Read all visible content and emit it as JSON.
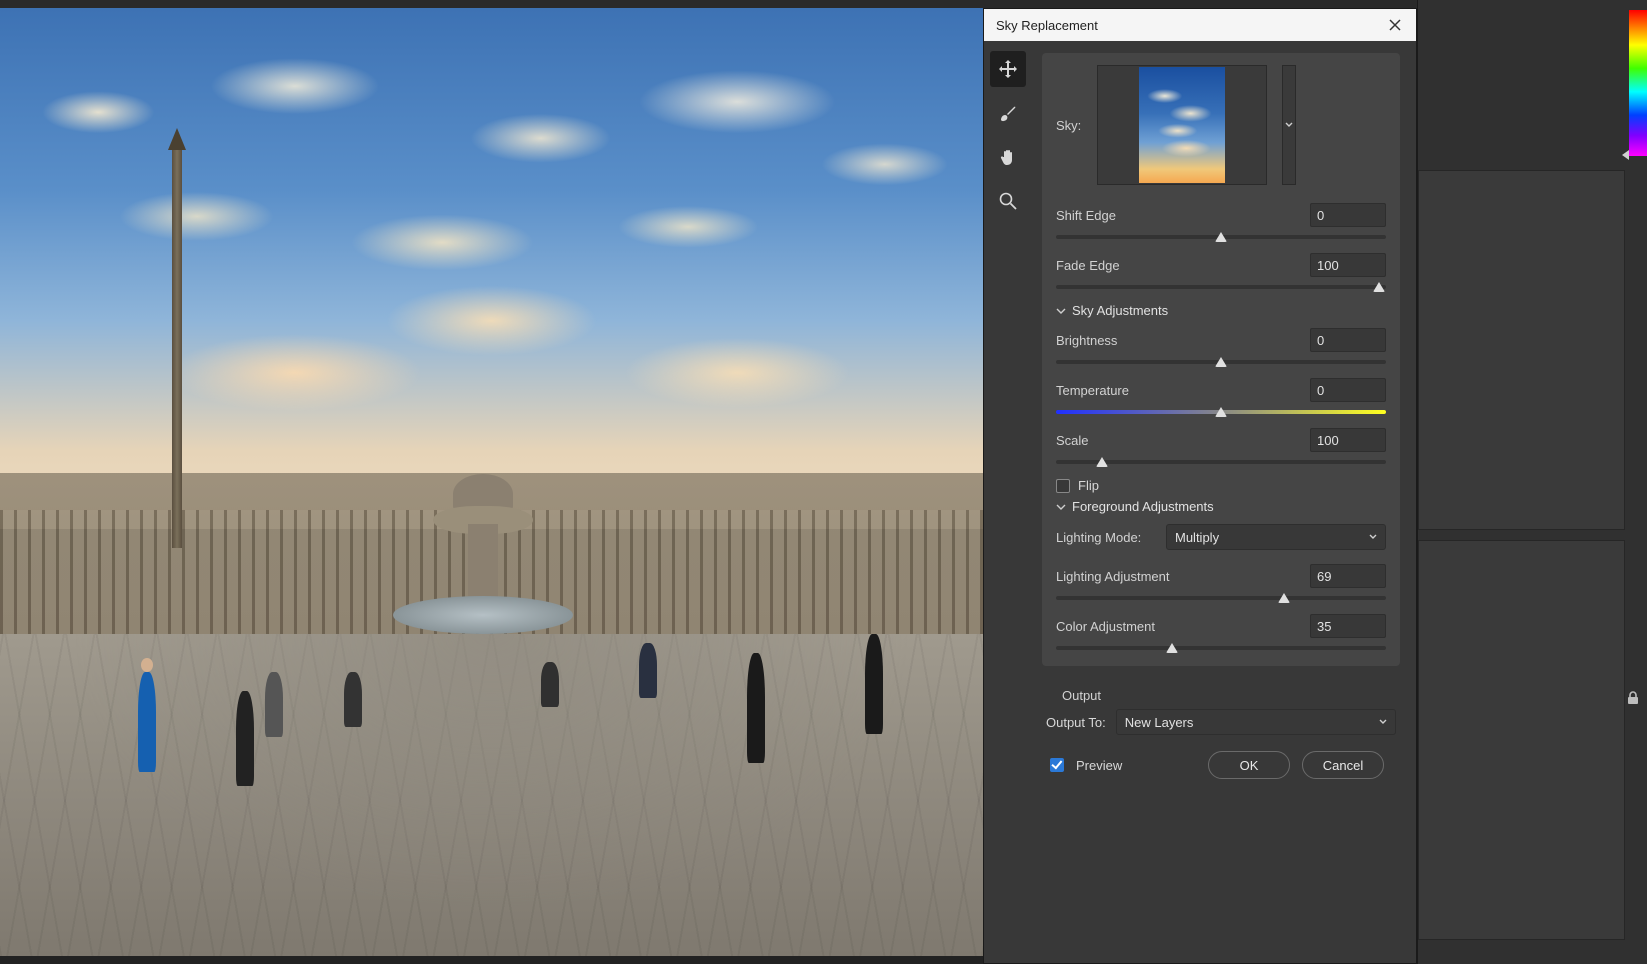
{
  "dialog": {
    "title": "Sky Replacement",
    "skyLabel": "Sky:",
    "shiftEdge": {
      "label": "Shift Edge",
      "value": "0",
      "pos": 50
    },
    "fadeEdge": {
      "label": "Fade Edge",
      "value": "100",
      "pos": 98
    },
    "skyAdjTitle": "Sky Adjustments",
    "brightness": {
      "label": "Brightness",
      "value": "0",
      "pos": 50
    },
    "temperature": {
      "label": "Temperature",
      "value": "0",
      "pos": 50
    },
    "scale": {
      "label": "Scale",
      "value": "100",
      "pos": 14
    },
    "flipLabel": "Flip",
    "fgTitle": "Foreground Adjustments",
    "lightingModeLabel": "Lighting Mode:",
    "lightingModeValue": "Multiply",
    "lightingAdj": {
      "label": "Lighting Adjustment",
      "value": "69",
      "pos": 69
    },
    "colorAdj": {
      "label": "Color Adjustment",
      "value": "35",
      "pos": 35
    },
    "outputTitle": "Output",
    "outputToLabel": "Output To:",
    "outputToValue": "New Layers",
    "previewLabel": "Preview",
    "okLabel": "OK",
    "cancelLabel": "Cancel"
  }
}
